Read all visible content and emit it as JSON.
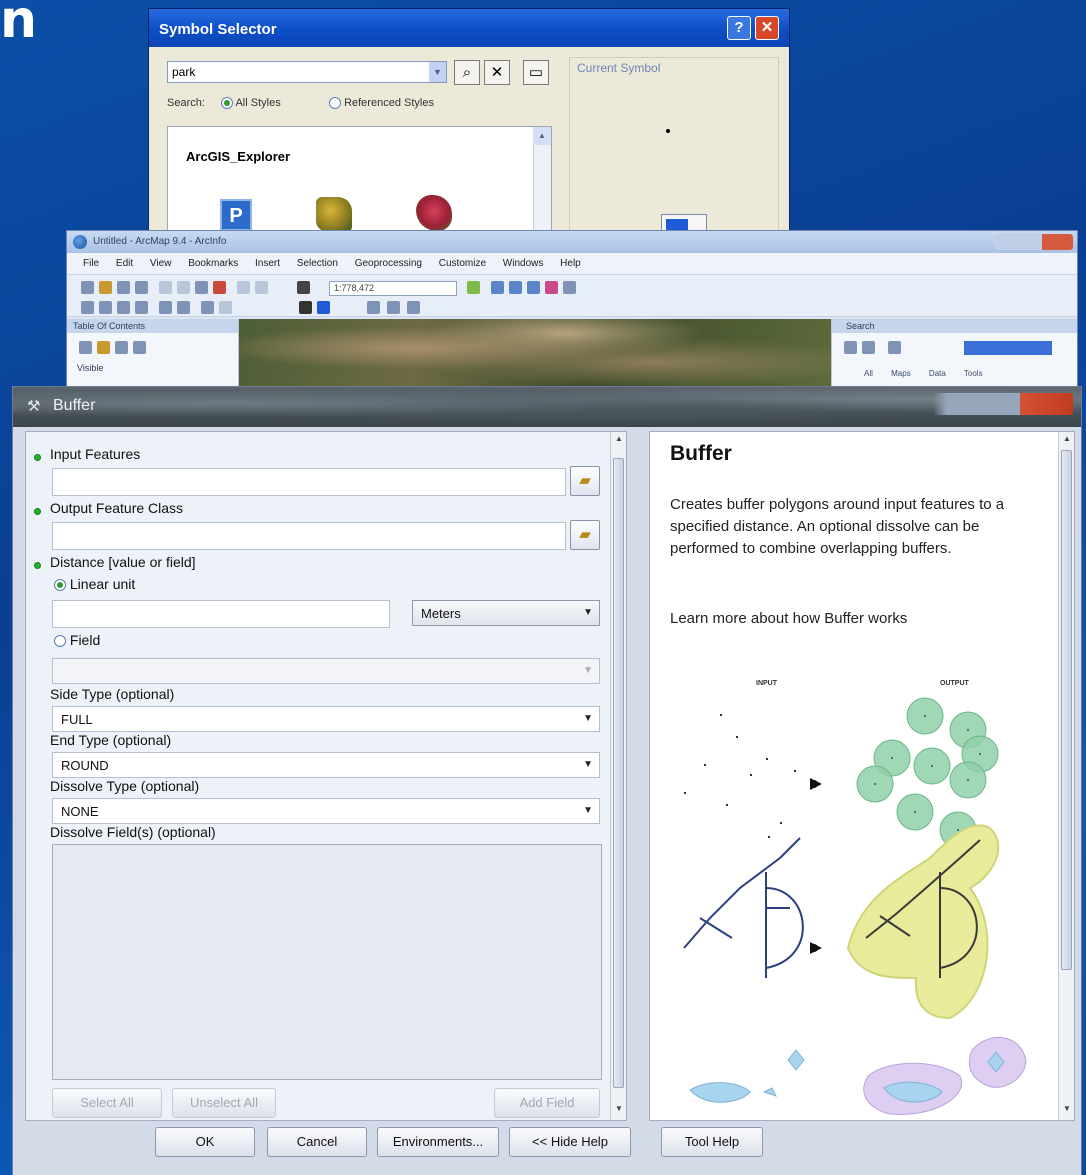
{
  "slide_fragment": "n",
  "symbol_selector": {
    "title": "Symbol Selector",
    "search_value": "park",
    "search_label": "Search:",
    "radio_all_styles": "All Styles",
    "radio_referenced_styles": "Referenced Styles",
    "list_group": "ArcGIS_Explorer",
    "current_symbol_label": "Current Symbol",
    "help_glyph": "?",
    "close_glyph": "✕"
  },
  "arcmap": {
    "title": "Untitled - ArcMap 9.4 - ArcInfo",
    "menu": [
      "File",
      "Edit",
      "View",
      "Bookmarks",
      "Insert",
      "Selection",
      "Geoprocessing",
      "Customize",
      "Windows",
      "Help"
    ],
    "scale_value": "1:778,472",
    "toc_title": "Table Of Contents",
    "toc_layer": "Visible",
    "search_title": "Search",
    "search_tabs": [
      "All",
      "Maps",
      "Data",
      "Tools"
    ]
  },
  "buffer": {
    "title": "Buffer",
    "input_features_label": "Input Features",
    "output_feature_class_label": "Output Feature Class",
    "distance_label": "Distance [value or field]",
    "linear_unit_label": "Linear unit",
    "units_value": "Meters",
    "field_label": "Field",
    "side_type_label": "Side Type (optional)",
    "side_type_value": "FULL",
    "end_type_label": "End Type (optional)",
    "end_type_value": "ROUND",
    "dissolve_type_label": "Dissolve Type (optional)",
    "dissolve_type_value": "NONE",
    "dissolve_fields_label": "Dissolve Field(s) (optional)",
    "select_all": "Select All",
    "unselect_all": "Unselect All",
    "add_field": "Add Field",
    "ok": "OK",
    "cancel": "Cancel",
    "environments": "Environments...",
    "hide_help": "<< Hide Help",
    "tool_help": "Tool Help"
  },
  "help": {
    "title": "Buffer",
    "description": "Creates buffer polygons around input features to a specified distance. An optional dissolve can be performed to combine overlapping buffers.",
    "learn_more": "Learn more about how Buffer works",
    "illustration_input_label": "INPUT",
    "illustration_output_label": "OUTPUT"
  },
  "colors": {
    "slide_bg": "#0b4fa8",
    "xp_title": "#0d4ec8",
    "required_dot": "#27b02b",
    "buffer_point": "#8fd0a8",
    "buffer_line": "#e8ec9a",
    "buffer_poly": "#d9c9f1"
  }
}
